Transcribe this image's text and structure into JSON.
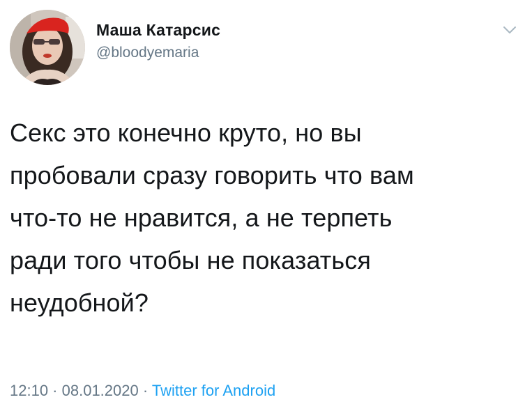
{
  "author": {
    "display_name": "Маша Катарсис",
    "handle": "@bloodyemaria"
  },
  "tweet": {
    "text": "Секс это конечно круто, но вы\nпробовали сразу говорить что вам\nчто-то не нравится, а не терпеть\nради того чтобы не показаться\nнеудобной?"
  },
  "meta": {
    "time": "12:10",
    "separator1": " · ",
    "date": "08.01.2020",
    "separator2": " · ",
    "source": "Twitter for Android"
  },
  "icons": {
    "menu": "chevron-down-icon"
  },
  "colors": {
    "text": "#14171a",
    "secondary": "#657786",
    "link": "#1da1f2",
    "caret": "#aab8c2"
  }
}
